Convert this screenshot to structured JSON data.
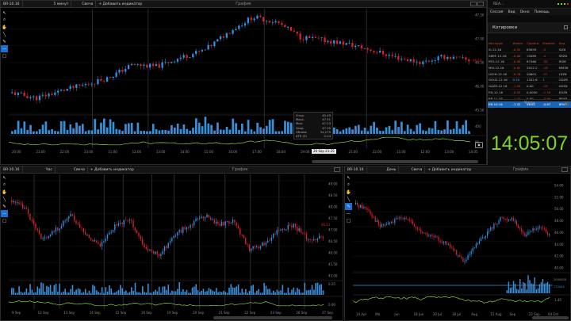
{
  "top_panel": {
    "instrument": "BR-10.16",
    "timeframe": "5 минут",
    "chart_type": "Свеча",
    "add_indicator": "+ Добавить индикатор",
    "title": "График",
    "price_ticks": [
      "47.50",
      "47.00",
      "46.50",
      "46.00",
      "45.50"
    ],
    "volume_ticks": [
      "400"
    ],
    "osc_ticks": [
      "80"
    ],
    "time_ticks": [
      "20:00",
      "21:00",
      "22:00",
      "23:00",
      "11:00",
      "12:00",
      "13:00",
      "14:00",
      "15:00",
      "16:00",
      "17:00",
      "18:00",
      "19:00",
      "20:00",
      "21:00",
      "22:00",
      "11:00",
      "12:00",
      "13:00",
      "14:05"
    ],
    "last_price_tag": "46.61",
    "cursor_date_tag": "26 Sep 21:25",
    "tooltip": {
      "open_label": "Откр.",
      "open": "45.49",
      "max_label": "Макс.",
      "max": "47.51",
      "min_label": "Мин.",
      "min": "47.23",
      "close_label": "Закр.",
      "close": "47.35",
      "volume_label": "Объём:",
      "volume": "34,275",
      "atr_label": "ATR (5)",
      "atr": "0.14"
    }
  },
  "app_window": {
    "title": "REA...",
    "menu": [
      "Сессия",
      "Вид",
      "Окно",
      "Помощь"
    ]
  },
  "quotes": {
    "title": "Котировки",
    "columns": [
      "Инструм",
      "Измен",
      "Сделки",
      "Измене",
      "Код"
    ],
    "rows": [
      {
        "name": "Si-12.16",
        "change": "-0.55",
        "deals": "65659",
        "delta": "-5",
        "code": "SiZ6",
        "neg": true
      },
      {
        "name": "SBRF-12.16",
        "change": "-0.06",
        "deals": "15089",
        "delta": "-4",
        "code": "SRZ6",
        "neg": true
      },
      {
        "name": "RTS-12.16",
        "change": "-0.96",
        "deals": "87460",
        "delta": "-50",
        "code": "RIZ6",
        "neg": true
      },
      {
        "name": "MIX-12.16",
        "change": "-0.82",
        "deals": "2012.2",
        "delta": "-18",
        "code": "MMZ6",
        "neg": true
      },
      {
        "name": "LKOH-12.16",
        "change": "-0.76",
        "deals": "20601",
        "delta": "-27",
        "code": "LKZ6",
        "neg": true
      },
      {
        "name": "GOLD-12.16",
        "change": "0.10",
        "deals": "1342.6",
        "delta": "1",
        "code": "GDZ6",
        "neg": false
      },
      {
        "name": "GAZR-12.16",
        "change": "-1.09",
        "deals": "0.00",
        "delta": "-15",
        "code": "GZZ6",
        "neg": true
      },
      {
        "name": "ED-12.16",
        "change": "-0.03",
        "deals": "0.0000",
        "delta": "-1.18",
        "code": "EDZ6",
        "neg": true
      },
      {
        "name": "BR-11.16",
        "change": "-1.40",
        "deals": "0.00",
        "delta": "-0.66",
        "code": "BRX6",
        "neg": true
      },
      {
        "name": "BR-10.16",
        "change": "-1.42",
        "deals": "46.61",
        "delta": "-0.67",
        "code": "BRV6",
        "neg": true,
        "selected": true
      }
    ]
  },
  "clock": {
    "title": "Часы",
    "time": "14:05:07"
  },
  "bl_panel": {
    "instrument": "BR-10.16",
    "timeframe": "Час",
    "chart_type": "Свеча",
    "add_indicator": "+ Добавить индикатор",
    "title": "График",
    "price_ticks": [
      "49.00",
      "48.50",
      "48.00",
      "47.50",
      "47.00",
      "46.50",
      "46.00",
      "45.50",
      "45.00"
    ],
    "osc_ticks": [
      "0.25",
      "0.00"
    ],
    "date_ticks": [
      "9 Sep",
      "12 Sep",
      "13 Sep",
      "14 Sep",
      "15 Sep",
      "16 Sep",
      "19 Sep",
      "20 Sep",
      "21 Sep",
      "22 Sep",
      "23 Sep",
      "26 Sep",
      "27 Sep"
    ],
    "last_price_tag": "46.61"
  },
  "br_panel": {
    "instrument": "BR-10.16",
    "timeframe": "День",
    "chart_type": "Свеча",
    "add_indicator": "+ Добавить индикатор",
    "title": "График",
    "price_ticks": [
      "54.00",
      "52.00",
      "50.00",
      "48.00",
      "46.00",
      "44.00",
      "42.00",
      "40.00"
    ],
    "volume_ticks": [
      "2000000",
      "772043"
    ],
    "osc_ticks": [
      "1.45"
    ],
    "date_ticks": [
      "14 Apr",
      "Ma",
      "Jun",
      "18 Jun",
      "30 Jul",
      "18 Jul",
      "Aug",
      "15 Aug",
      "Sep",
      "22 Sep",
      "04 Oct"
    ]
  },
  "colors": {
    "up": "#2f8fe0",
    "down": "#d81f2a",
    "volume": "#3a8fd9",
    "oscillator": "#8ad23a",
    "clock": "#7ed321",
    "selected_row": "#1b64b3"
  }
}
